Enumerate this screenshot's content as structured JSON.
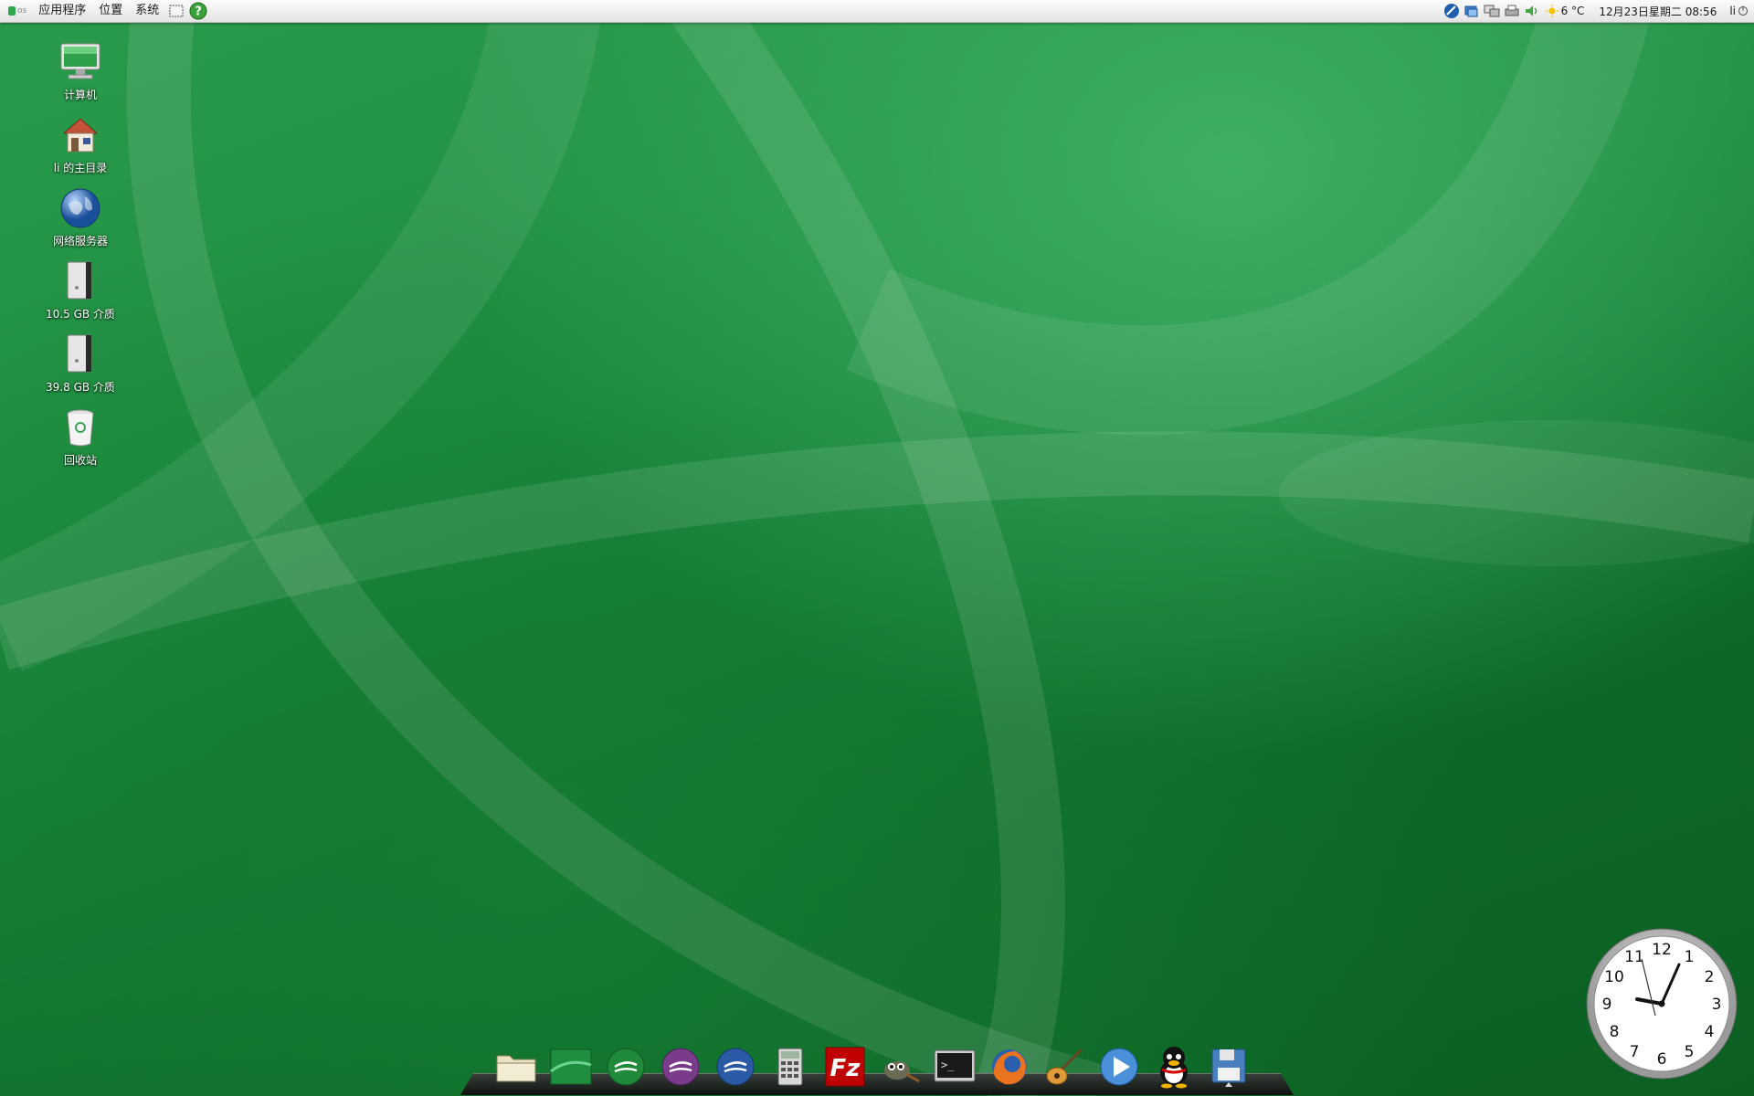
{
  "top_panel": {
    "logo_text": "os",
    "menus": {
      "applications": "应用程序",
      "places": "位置",
      "system": "系统"
    },
    "launchers": [
      "screenshot-icon",
      "help-icon"
    ],
    "tray_icons": [
      "network-icon",
      "display-icon",
      "network-manager-icon",
      "printer-icon",
      "volume-icon"
    ],
    "weather": {
      "icon": "sun-icon",
      "temperature": "6 °C"
    },
    "datetime": "12月23日星期二 08:56",
    "user": "li"
  },
  "desktop": {
    "icons": [
      {
        "name": "computer",
        "icon": "monitor-icon",
        "label": "计算机"
      },
      {
        "name": "home",
        "icon": "home-icon",
        "label": "li 的主目录"
      },
      {
        "name": "network",
        "icon": "globe-icon",
        "label": "网络服务器"
      },
      {
        "name": "drive-10gb",
        "icon": "drive-icon",
        "label": "10.5 GB 介质"
      },
      {
        "name": "drive-40gb",
        "icon": "drive-icon",
        "label": "39.8 GB 介质"
      },
      {
        "name": "trash",
        "icon": "trash-icon",
        "label": "回收站"
      }
    ]
  },
  "dock": {
    "items": [
      "file-manager-icon",
      "wallpaper-icon",
      "openoffice-calc-icon",
      "openoffice-impress-icon",
      "openoffice-writer-icon",
      "calculator-icon",
      "filezilla-icon",
      "gimp-icon",
      "terminal-icon",
      "firefox-icon",
      "guitar-icon",
      "media-player-icon",
      "qq-icon",
      "save-icon"
    ]
  },
  "analog_clock": {
    "numbers": [
      "12",
      "1",
      "2",
      "3",
      "4",
      "5",
      "6",
      "7",
      "8",
      "9",
      "10",
      "11"
    ]
  },
  "colors": {
    "wallpaper_green": "#1b8a3a",
    "panel_bg": "#ececec",
    "accent_red": "#c8102e"
  }
}
